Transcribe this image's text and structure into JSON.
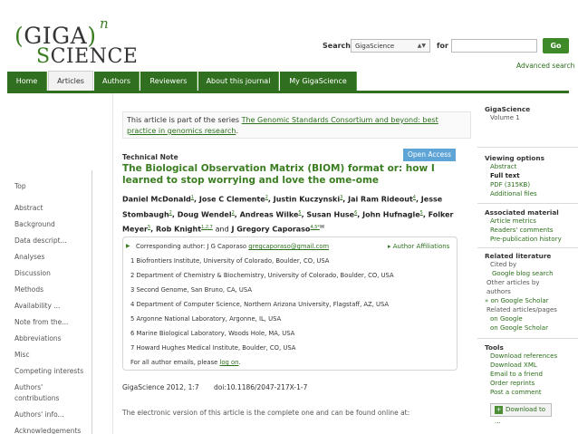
{
  "header": {
    "logo_top": "(GIGA)",
    "logo_n": "n",
    "logo_bottom": "SCIENCE",
    "search_label": "Search",
    "search_select_value": "GigaScience",
    "for_label": "for",
    "search_input_value": "",
    "go_label": "Go",
    "advanced_search": "Advanced search"
  },
  "nav": {
    "tabs": [
      {
        "label": "Home"
      },
      {
        "label": "Articles"
      },
      {
        "label": "Authors"
      },
      {
        "label": "Reviewers"
      },
      {
        "label": "About this journal"
      },
      {
        "label": "My GigaScience"
      }
    ],
    "active_tab": "Articles"
  },
  "left_sidebar": {
    "items": [
      "Top",
      "Abstract",
      "Background",
      "Data descript...",
      "Analyses",
      "Discussion",
      "Methods",
      "Availability ...",
      "Note from the...",
      "Abbreviations",
      "Misc",
      "Competing interests",
      "Authors'",
      "contributions",
      "Authors' info...",
      "Acknowledgements"
    ]
  },
  "series": {
    "prefix": "This article is part of the series ",
    "link": "The Genomic Standards Consortium and beyond: best practice in genomics research",
    "suffix": "."
  },
  "article": {
    "type": "Technical Note",
    "open_access": "Open Access",
    "title": "The Biological Observation Matrix (BIOM) format or: how I learned to stop worrying and love the ome-ome",
    "authors": [
      {
        "name": "Daniel McDonald",
        "sup": "1"
      },
      {
        "name": "Jose C Clemente",
        "sup": "2"
      },
      {
        "name": "Justin Kuczynski",
        "sup": "3"
      },
      {
        "name": "Jai Ram Rideout",
        "sup": "4"
      },
      {
        "name": "Jesse Stombaugh",
        "sup": "2"
      },
      {
        "name": "Doug Wendel",
        "sup": "2"
      },
      {
        "name": "Andreas Wilke",
        "sup": "5"
      },
      {
        "name": "Susan Huse",
        "sup": "6"
      },
      {
        "name": "John Hufnagle",
        "sup": "5"
      },
      {
        "name": "Folker Meyer",
        "sup": "5"
      },
      {
        "name": "Rob Knight",
        "sup": "1,2,7"
      },
      {
        "name": "J Gregory Caporaso",
        "sup": "4,5*"
      }
    ],
    "and_text": "and",
    "corresponding_label": "Corresponding author: J G Caporaso",
    "corresponding_email": "gregcaporaso@gmail.com",
    "author_affiliations": "Author Affiliations",
    "affiliations": [
      "1 Biofrontiers Institute, University of Colorado, Boulder, CO, USA",
      "2 Department of Chemistry & Biochemistry, University of Colorado, Boulder, CO, USA",
      "3 Second Genome, San Bruno, CA, USA",
      "4 Department of Computer Science, Northern Arizona University, Flagstaff, AZ, USA",
      "5 Argonne National Laboratory, Argonne, IL, USA",
      "6 Marine Biological Laboratory, Woods Hole, MA, USA",
      "7 Howard Hughes Medical Institute, Boulder, CO, USA"
    ],
    "all_emails_prefix": "For all author emails, please ",
    "all_emails_link": "log on",
    "all_emails_suffix": ".",
    "citation": "GigaScience 2012, 1:7",
    "doi": "doi:10.1186/2047-217X-1-7",
    "electronic": "The electronic version of this article is the complete one and can be found online at:"
  },
  "right_sidebar": {
    "journal": "GigaScience",
    "volume": "Volume 1",
    "viewing_options": "Viewing options",
    "abstract": "Abstract",
    "full_text": "Full text",
    "pdf": "PDF  (315KB)",
    "additional_files": "Additional files",
    "associated_material": "Associated material",
    "article_metrics": "Article metrics",
    "readers_comments": "Readers' comments",
    "pre_pub_history": "Pre-publication history",
    "related_literature": "Related literature",
    "cited_by": "Cited by",
    "google_blog_search": "Google blog search",
    "other_articles": "Other articles by",
    "authors_label": "authors",
    "on_google_scholar": "on Google Scholar",
    "related_articles": "Related articles/pages",
    "on_google": "on Google",
    "on_google_scholar2": "on Google Scholar",
    "tools": "Tools",
    "download_references": "Download references",
    "download_xml": "Download XML",
    "email_friend": "Email to a friend",
    "order_reprints": "Order reprints",
    "post_comment": "Post a comment",
    "download_to": "Download to ..."
  }
}
